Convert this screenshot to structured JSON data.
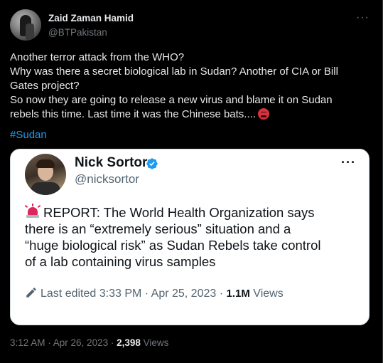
{
  "author": {
    "name": "Zaid Zaman Hamid",
    "handle": "@BTPakistan"
  },
  "more_label": "···",
  "tweet": {
    "lines": [
      "Another terror attack from the WHO?",
      "Why was there a secret biological lab in Sudan? Another of CIA or Bill",
      "Gates project?",
      "So now they are going to release a new virus and blame it on Sudan",
      "rebels this time. Last time it was the Chinese bats...."
    ],
    "emoji_icon": "angry-face-icon",
    "hashtag": "#Sudan"
  },
  "quote": {
    "name": "Nick Sortor",
    "handle": "@nicksortor",
    "verified_icon": "verified-badge-icon",
    "more_label": "···",
    "lines": [
      "REPORT: The World Health Organization says",
      "there is an “extremely serious” situation and a",
      "“huge biological risk” as Sudan Rebels take control",
      "of a lab containing virus samples"
    ],
    "siren_icon": "rotating-light-icon",
    "edited": "Last edited 3:33 PM · Apr 25, 2023 · ",
    "views_count": "1.1M",
    "views_label": " Views"
  },
  "footer": {
    "timestamp": "3:12 AM · Apr 26, 2023 · ",
    "views_count": "2,398",
    "views_label": " Views"
  },
  "colors": {
    "background": "#000000",
    "text": "#e7e9ea",
    "muted": "#71767b",
    "link": "#1d9bf0",
    "quote_background": "#ffffff",
    "verified": "#1d9bf0"
  }
}
